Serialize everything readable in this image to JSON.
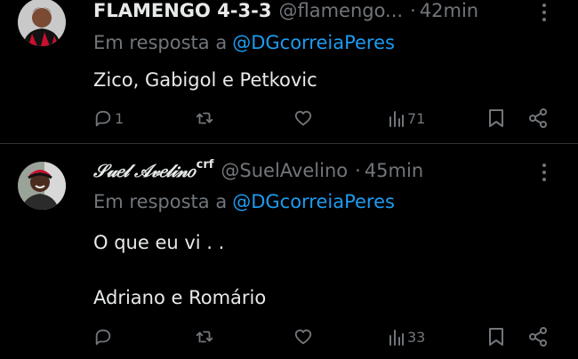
{
  "tweets": [
    {
      "name": "FLAMENGO 4-3-3",
      "handle": "@flamengo...",
      "time": "42min",
      "reply_prefix": "Em resposta a",
      "reply_to": "@DGcorreiaPeres",
      "text_lines": [
        "Zico, Gabigol e Petkovic"
      ],
      "replies": "1",
      "views": "71"
    },
    {
      "name": "𝒮𝓊𝑒𝓁 𝒜𝓋𝑒𝓁𝒾𝓃𝑜",
      "name_suffix": "crf",
      "handle": "@SuelAvelino",
      "time": "45min",
      "reply_prefix": "Em resposta a",
      "reply_to": "@DGcorreiaPeres",
      "text_lines": [
        "O que eu vi . .",
        "Adriano e Romário"
      ],
      "replies": "",
      "views": "33"
    }
  ],
  "colors": {
    "background": "#000000",
    "text": "#e7e9ea",
    "muted": "#71767b",
    "link": "#1d9bf0",
    "divider": "#2f3336"
  }
}
